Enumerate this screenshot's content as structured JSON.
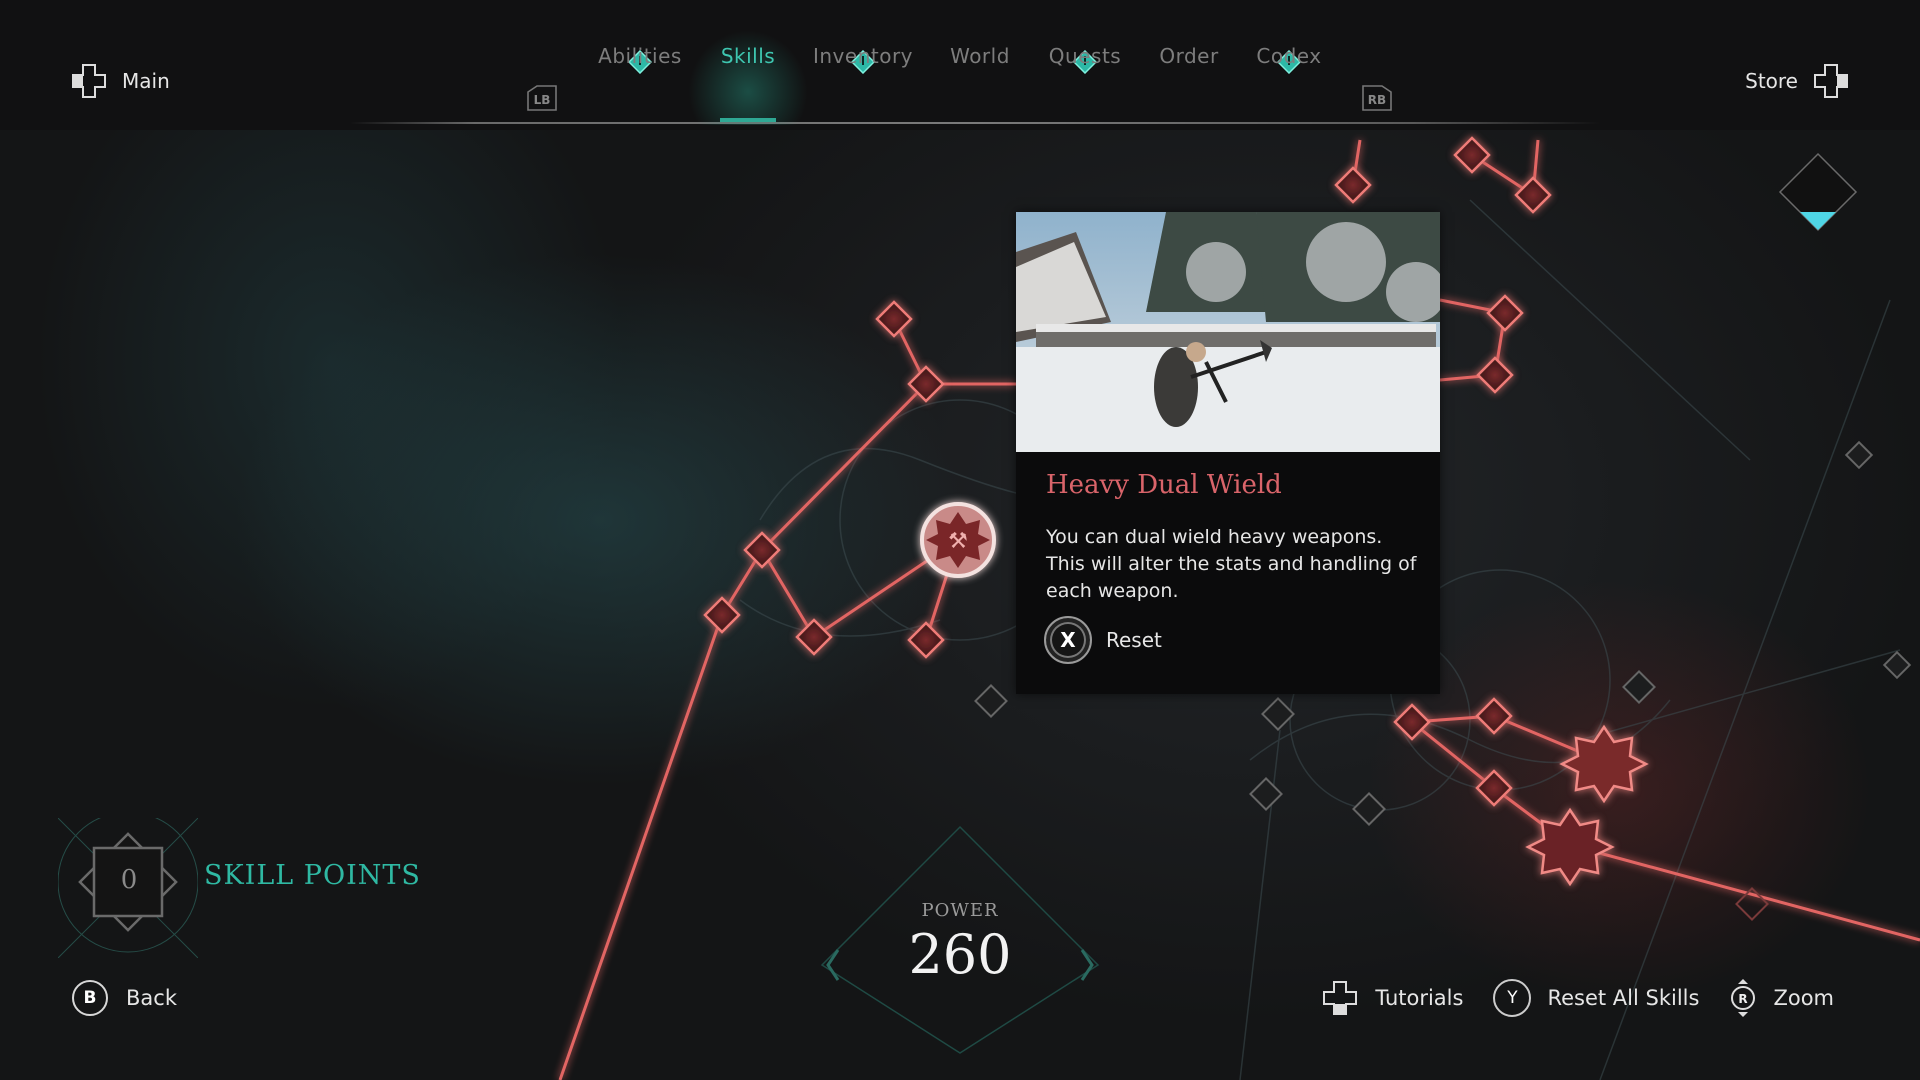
{
  "header": {
    "left_nav": {
      "label": "Main",
      "icon": "dpad-left-icon"
    },
    "right_nav": {
      "label": "Store",
      "icon": "dpad-right-icon"
    },
    "bumper_left": "LB",
    "bumper_right": "RB",
    "tabs": [
      {
        "label": "Abilities",
        "alert": true,
        "active": false
      },
      {
        "label": "Skills",
        "alert": false,
        "active": true
      },
      {
        "label": "Inventory",
        "alert": true,
        "active": false
      },
      {
        "label": "World",
        "alert": false,
        "active": false
      },
      {
        "label": "Quests",
        "alert": true,
        "active": false
      },
      {
        "label": "Order",
        "alert": false,
        "active": false
      },
      {
        "label": "Codex",
        "alert": true,
        "active": false
      }
    ]
  },
  "skill_detail": {
    "title": "Heavy Dual Wield",
    "description": "You can dual wield heavy weapons. This will alter the stats and handling of each weapon.",
    "action_button": "X",
    "action_label": "Reset",
    "image": "snowy-warrior-dual-wield-preview"
  },
  "skill_points": {
    "value": "0",
    "label": "SKILL POINTS"
  },
  "power": {
    "label": "POWER",
    "value": "260"
  },
  "rank_progress": 0.25,
  "footer": {
    "back": {
      "button": "B",
      "label": "Back"
    },
    "actions": [
      {
        "button": "dpad-down",
        "label": "Tutorials"
      },
      {
        "button": "Y",
        "label": "Reset All Skills"
      },
      {
        "button": "R",
        "label": "Zoom"
      }
    ]
  },
  "colors": {
    "accent_teal": "#2fb9a3",
    "skill_red": "#e0625f",
    "title_red": "#d9646a",
    "rank_fill": "#4fd6e6"
  }
}
